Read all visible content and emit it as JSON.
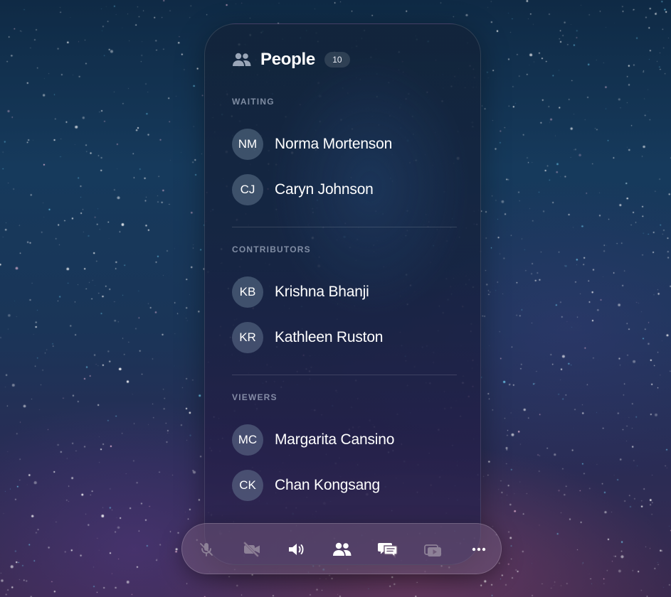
{
  "header": {
    "title": "People",
    "count": "10",
    "icon": "people-icon"
  },
  "sections": [
    {
      "label": "WAITING",
      "people": [
        {
          "initials": "NM",
          "name": "Norma Mortenson"
        },
        {
          "initials": "CJ",
          "name": "Caryn Johnson"
        }
      ]
    },
    {
      "label": "CONTRIBUTORS",
      "people": [
        {
          "initials": "KB",
          "name": "Krishna Bhanji"
        },
        {
          "initials": "KR",
          "name": "Kathleen Ruston"
        }
      ]
    },
    {
      "label": "VIEWERS",
      "people": [
        {
          "initials": "MC",
          "name": "Margarita Cansino"
        },
        {
          "initials": "CK",
          "name": "Chan Kongsang"
        }
      ]
    }
  ],
  "toolbar": {
    "buttons": [
      {
        "icon": "microphone-off-icon",
        "state": "disabled"
      },
      {
        "icon": "video-off-icon",
        "state": "disabled"
      },
      {
        "icon": "speaker-icon",
        "state": "enabled"
      },
      {
        "icon": "people-icon",
        "state": "active"
      },
      {
        "icon": "chat-icon",
        "state": "enabled"
      },
      {
        "icon": "share-screen-icon",
        "state": "disabled"
      },
      {
        "icon": "more-icon",
        "state": "enabled"
      }
    ]
  },
  "colors": {
    "text_primary": "#ffffff",
    "text_label": "#a9b4c6",
    "avatar_bg": "#5a6a80",
    "icon_disabled": "#8a7f94"
  }
}
